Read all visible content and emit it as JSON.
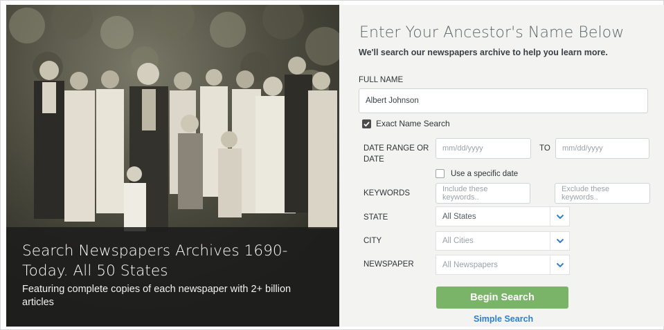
{
  "photo": {
    "caption_title": "Search Newspapers Archives 1690-Today. All 50 States",
    "caption_sub": "Featuring complete copies of each newspaper with 2+ billion articles"
  },
  "form": {
    "heading": "Enter Your Ancestor's Name Below",
    "subheading": "We'll search our newspapers archive to help you learn more.",
    "full_name_label": "FULL NAME",
    "full_name_value": "Albert Johnson",
    "exact_name_label": "Exact Name Search",
    "exact_name_checked": true,
    "date_range_label": "DATE RANGE OR DATE",
    "date_from_placeholder": "mm/dd/yyyy",
    "to_label": "TO",
    "date_to_placeholder": "mm/dd/yyyy",
    "specific_date_label": "Use a specific date",
    "specific_date_checked": false,
    "keywords_label": "KEYWORDS",
    "include_placeholder": "Include these keywords..",
    "exclude_placeholder": "Exclude these keywords..",
    "state_label": "STATE",
    "state_value": "All States",
    "city_label": "CITY",
    "city_value": "All Cities",
    "newspaper_label": "NEWSPAPER",
    "newspaper_value": "All Newspapers",
    "begin_button": "Begin Search",
    "simple_link": "Simple Search"
  },
  "colors": {
    "button_green": "#7ab468",
    "link_blue": "#2e7ec9",
    "chevron_blue": "#2e7ec9",
    "panel_bg": "#f3f4f2"
  },
  "icons": {
    "checkbox": "check-icon",
    "dropdown": "chevron-down-icon"
  }
}
